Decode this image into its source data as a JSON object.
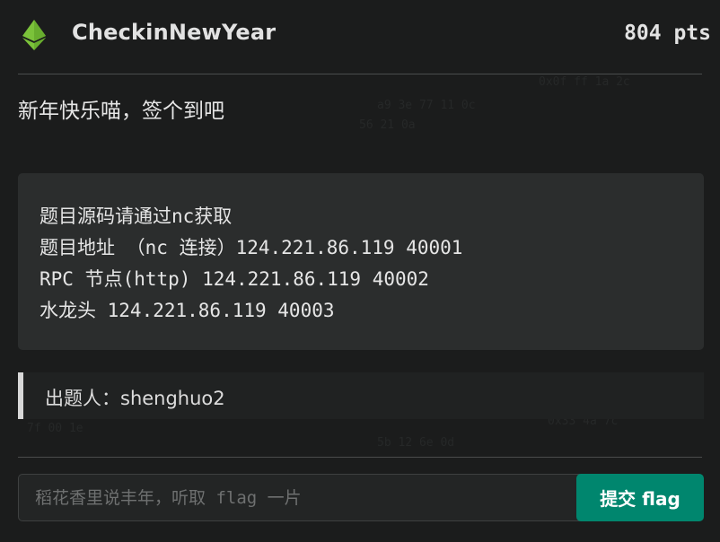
{
  "challenge": {
    "title": "CheckinNewYear",
    "points": "804 pts",
    "description": "新年快乐喵，签个到吧",
    "code_lines": [
      "题目源码请通过nc获取",
      "题目地址 （nc 连接）124.221.86.119 40001",
      "RPC 节点(http) 124.221.86.119 40002",
      "水龙头 124.221.86.119 40003"
    ],
    "author": "出题人：shenghuo2"
  },
  "submit": {
    "placeholder": "稻花香里说丰年，听取 flag 一片",
    "value": "",
    "button_label": "提交 flag"
  },
  "colors": {
    "accent": "#00866e",
    "logo": "#7bc23a",
    "background": "#1b1c1c"
  },
  "icons": {
    "logo": "ethereum-diamond-icon"
  }
}
